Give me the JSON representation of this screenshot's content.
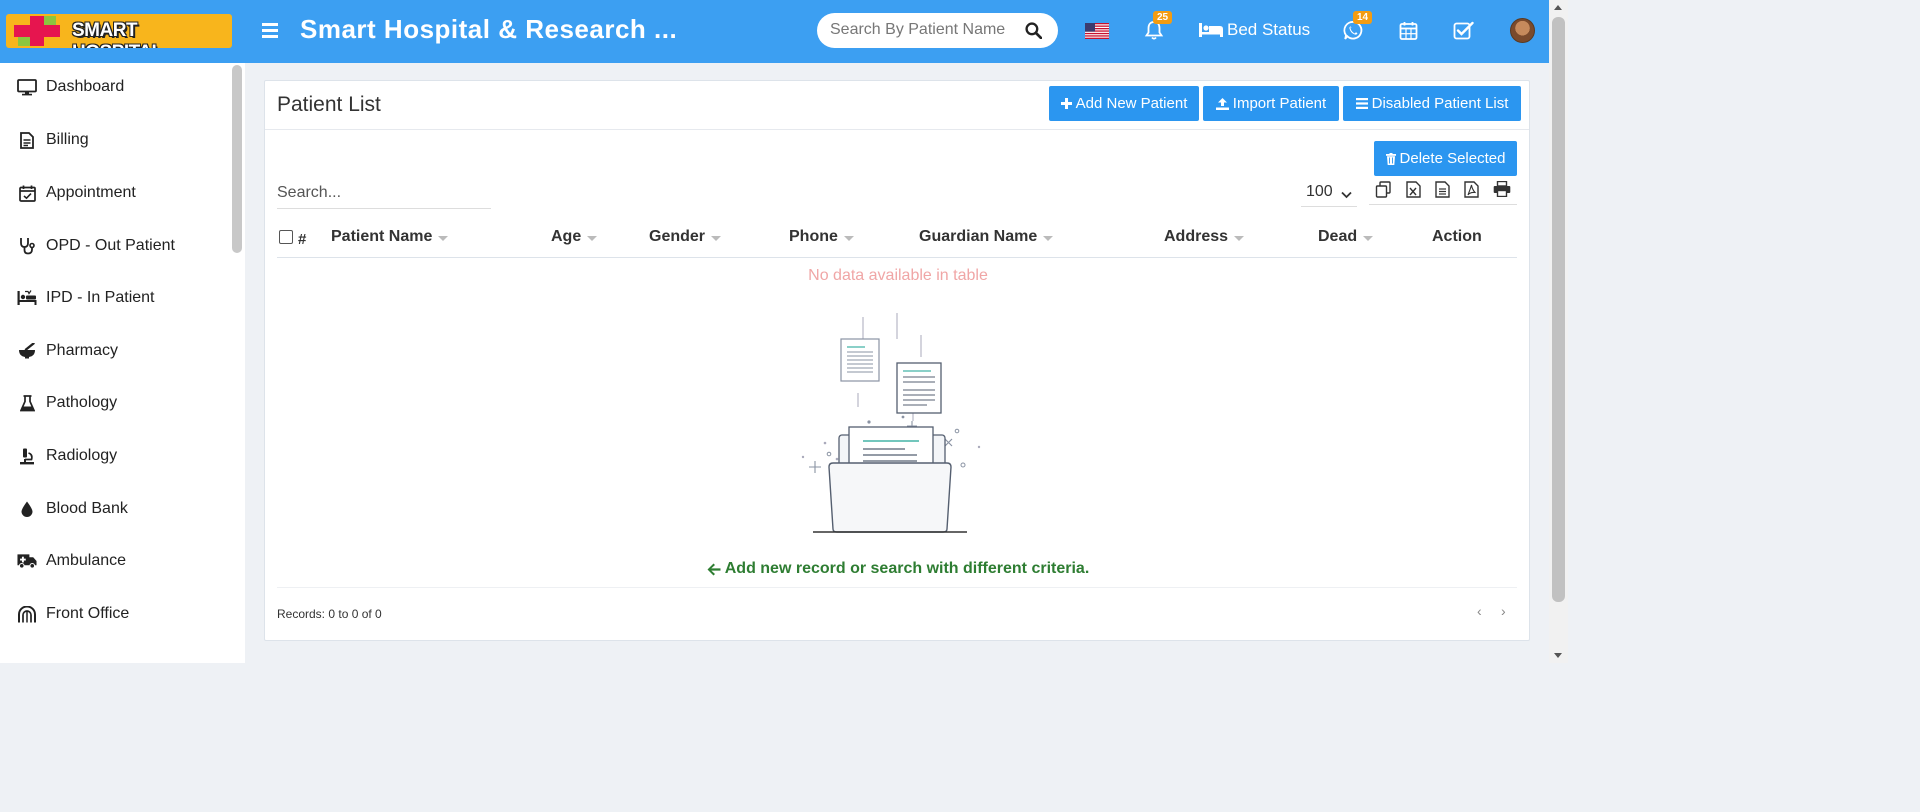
{
  "header": {
    "logo_text": "SMART HOSPITAL",
    "app_title": "Smart Hospital & Research ...",
    "search_placeholder": "Search By Patient Name",
    "notifications_count": "25",
    "bed_status_label": "Bed Status",
    "whatsapp_count": "14"
  },
  "sidebar": {
    "items": [
      {
        "label": "Dashboard",
        "icon": "monitor-icon"
      },
      {
        "label": "Billing",
        "icon": "file-invoice-icon"
      },
      {
        "label": "Appointment",
        "icon": "calendar-check-icon"
      },
      {
        "label": "OPD - Out Patient",
        "icon": "stethoscope-icon"
      },
      {
        "label": "IPD - In Patient",
        "icon": "procedures-icon"
      },
      {
        "label": "Pharmacy",
        "icon": "mortar-pestle-icon"
      },
      {
        "label": "Pathology",
        "icon": "flask-icon"
      },
      {
        "label": "Radiology",
        "icon": "microscope-icon"
      },
      {
        "label": "Blood Bank",
        "icon": "tint-icon"
      },
      {
        "label": "Ambulance",
        "icon": "ambulance-icon"
      },
      {
        "label": "Front Office",
        "icon": "dungeon-icon"
      }
    ]
  },
  "main": {
    "title": "Patient List",
    "buttons": {
      "add_new": "Add New Patient",
      "import": "Import Patient",
      "disabled_list": "Disabled Patient List",
      "delete_selected": "Delete Selected"
    },
    "table": {
      "search_placeholder": "Search...",
      "page_size": "100",
      "hash": "#",
      "columns": [
        "Patient Name",
        "Age",
        "Gender",
        "Phone",
        "Guardian Name",
        "Address",
        "Dead",
        "Action"
      ],
      "empty_message": "No data available in table",
      "hint": "Add new record or search with different criteria.",
      "records_info": "Records: 0 to 0 of 0",
      "pager_prev": "‹",
      "pager_next": "›"
    },
    "export_icons": [
      "copy-icon",
      "excel-icon",
      "csv-icon",
      "pdf-icon",
      "print-icon"
    ]
  },
  "colors": {
    "header_bg": "#3c9ff2",
    "button_bg": "#2b96f0",
    "badge_bg": "#f39c12",
    "logo_bg": "#f8b51c",
    "empty_text": "#f0a6a6",
    "hint_text": "#2e7d32"
  }
}
